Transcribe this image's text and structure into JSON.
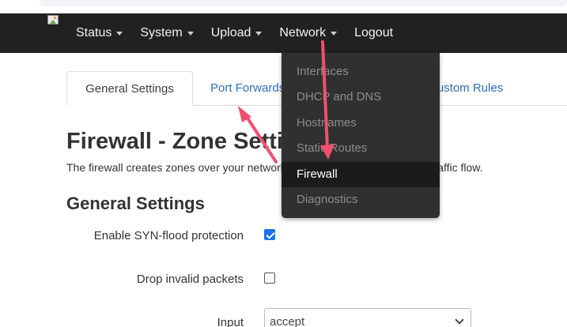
{
  "nav": {
    "brand_icon": "broken-image-icon",
    "items": [
      {
        "label": "Status",
        "has_caret": true
      },
      {
        "label": "System",
        "has_caret": true
      },
      {
        "label": "Upload",
        "has_caret": true
      },
      {
        "label": "Network",
        "has_caret": true
      },
      {
        "label": "Logout",
        "has_caret": false
      }
    ]
  },
  "network_menu": {
    "items": [
      "Interfaces",
      "DHCP and DNS",
      "Hostnames",
      "Static Routes",
      "Firewall",
      "Diagnostics"
    ],
    "active": "Firewall"
  },
  "tabs": {
    "general": "General Settings",
    "port_forwards": "Port Forwards",
    "custom_rules": "Custom Rules"
  },
  "page": {
    "title": "Firewall - Zone Settings",
    "description": "The firewall creates zones over your network interfaces to control network traffic flow."
  },
  "section": {
    "title": "General Settings",
    "fields": {
      "syn_flood": {
        "label": "Enable SYN-flood protection",
        "checked": true
      },
      "drop_invalid": {
        "label": "Drop invalid packets",
        "checked": false
      },
      "input": {
        "label": "Input",
        "value": "accept"
      }
    }
  },
  "colors": {
    "navbar": "#212121",
    "dropdown": "#303030",
    "link": "#2a6ebb",
    "annotation_arrow": "#f0506e",
    "checkbox_checked": "#1a73e8"
  }
}
